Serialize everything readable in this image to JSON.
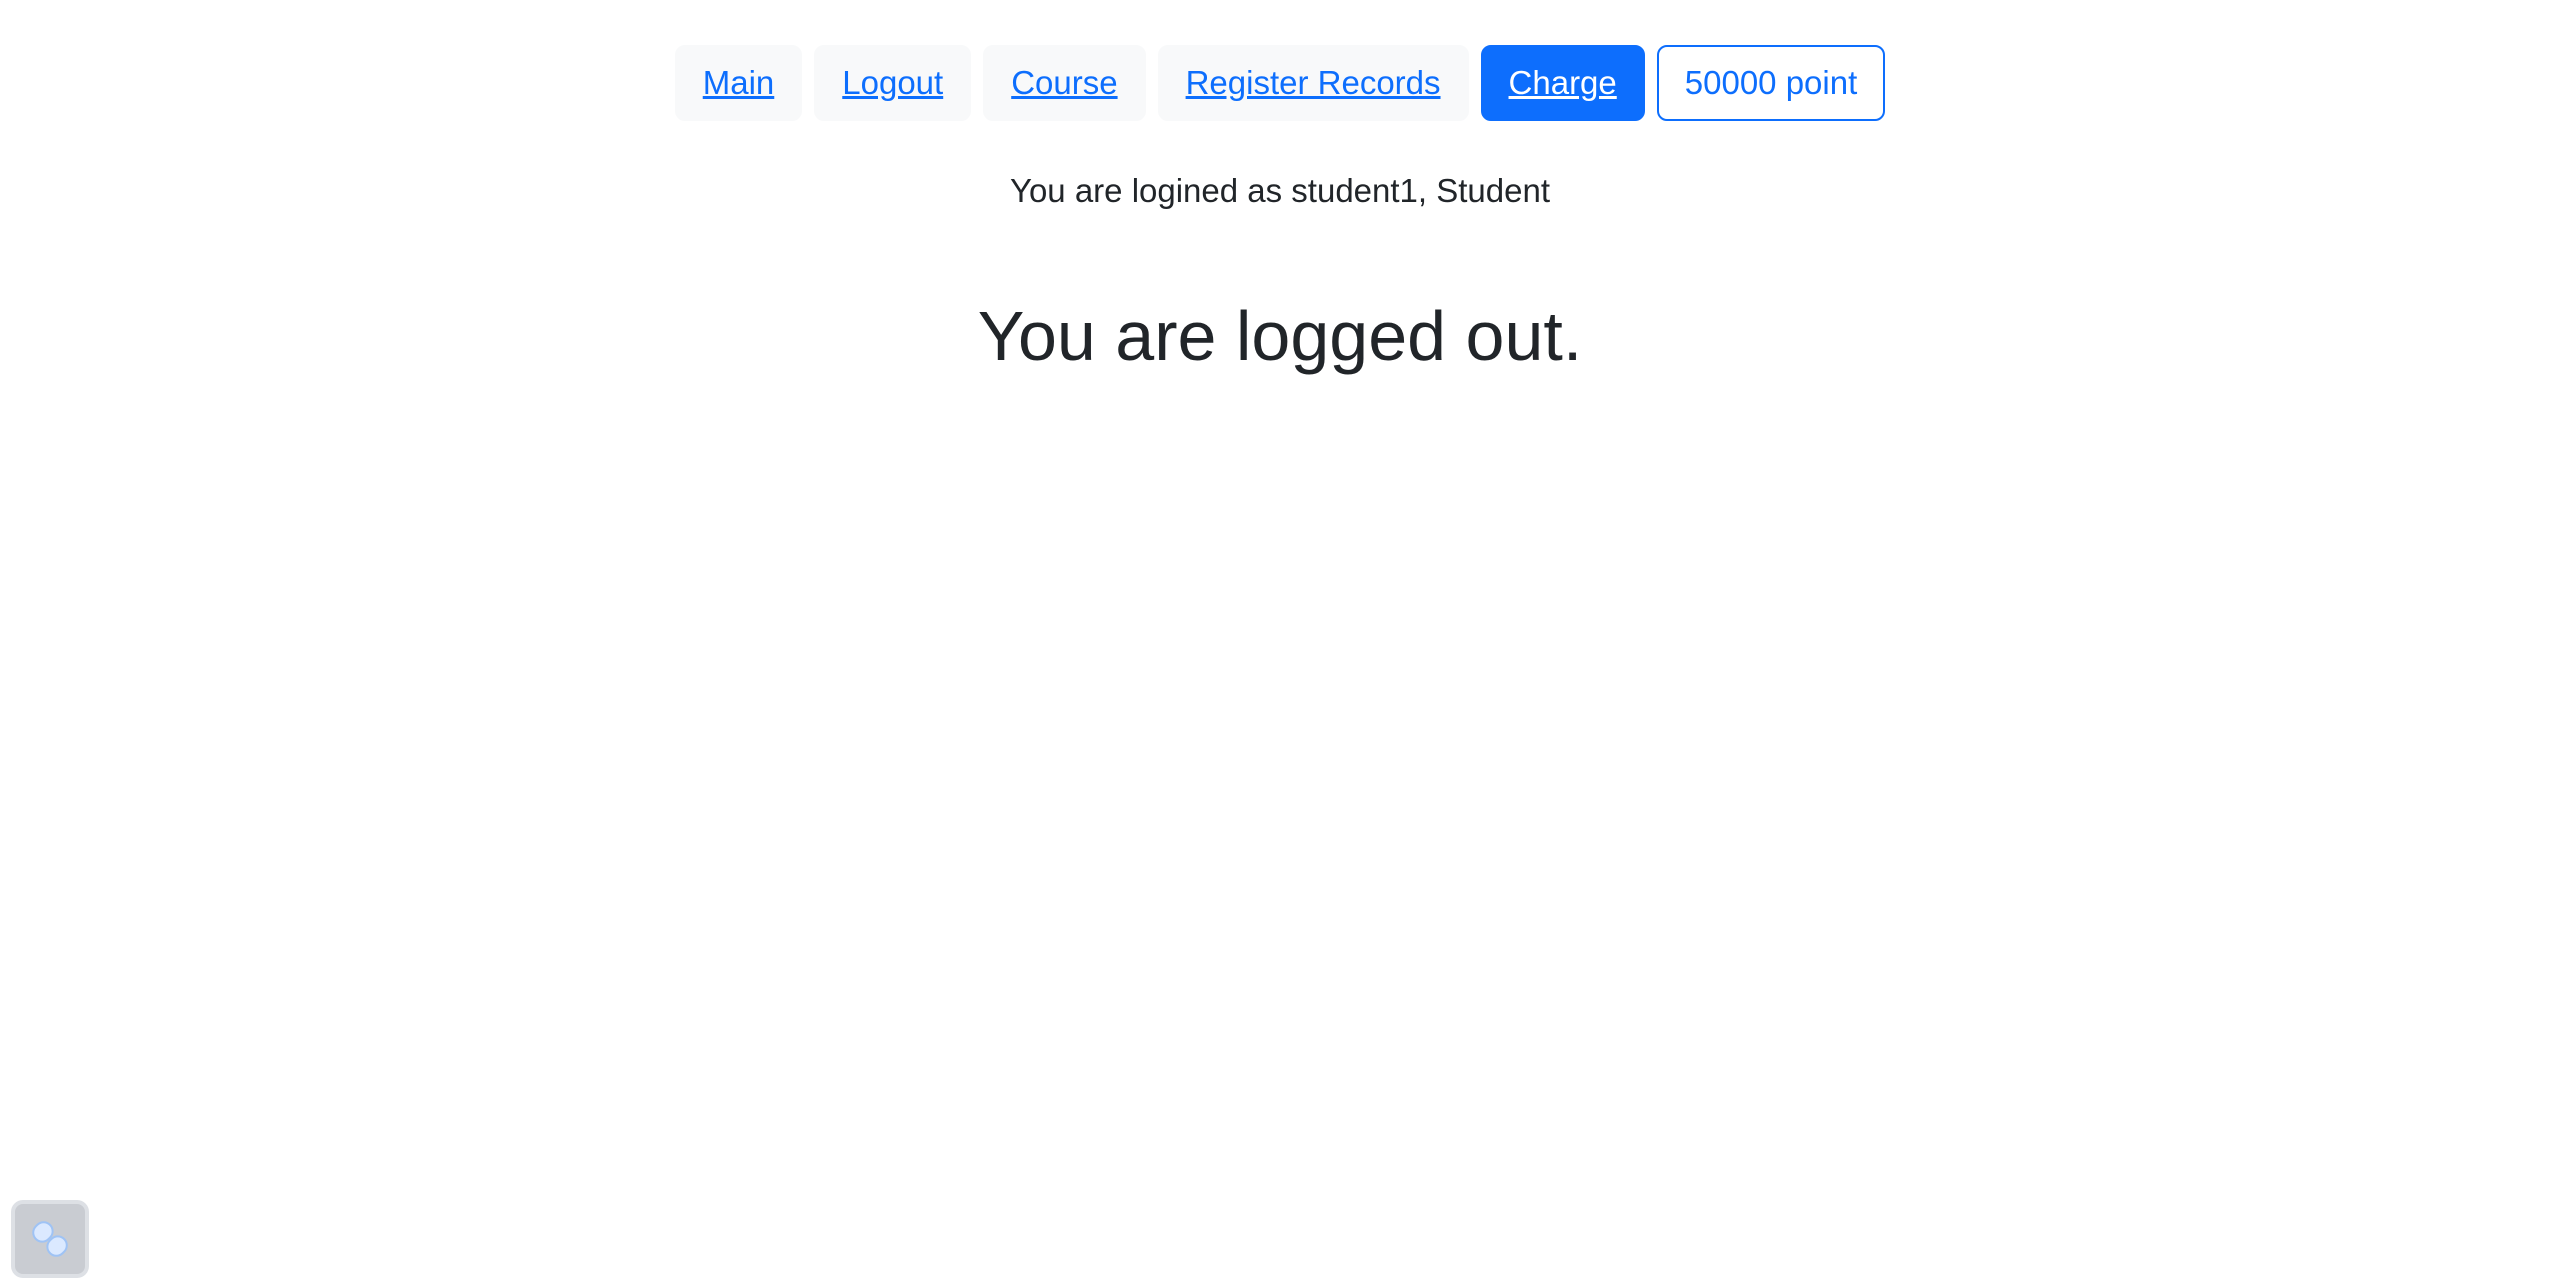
{
  "nav": {
    "items": [
      {
        "label": "Main"
      },
      {
        "label": "Logout"
      },
      {
        "label": "Course"
      },
      {
        "label": "Register Records"
      },
      {
        "label": "Charge"
      },
      {
        "label": "50000 point"
      }
    ]
  },
  "status": {
    "login_text": "You are logined as student1, Student"
  },
  "main": {
    "message": "You are logged out."
  },
  "widget": {
    "icon": "slash-pill-icon"
  },
  "colors": {
    "primary": "#0d6efd",
    "light": "#f8f9fa",
    "text": "#212529"
  }
}
